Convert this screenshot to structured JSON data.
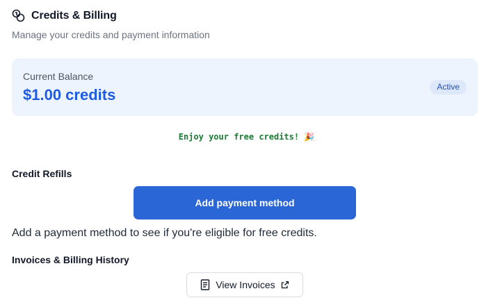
{
  "header": {
    "icon": "coins-icon",
    "title": "Credits & Billing",
    "subtitle": "Manage your credits and payment information"
  },
  "balance": {
    "label": "Current Balance",
    "value": "$1.00 credits",
    "status": "Active",
    "accent_color": "#1d5ce0",
    "card_color": "#eef4fd"
  },
  "promo": {
    "text": "Enjoy your free credits! 🎉",
    "color": "#1a7a33"
  },
  "credit_refills": {
    "title": "Credit Refills",
    "button_label": "Add payment method",
    "button_color": "#2b66d6",
    "hint": "Add a payment method to see if you're eligible for free credits."
  },
  "invoices": {
    "title": "Invoices & Billing History",
    "button_label": "View Invoices",
    "button_icon": "document-icon",
    "external_icon": "external-link-icon"
  }
}
